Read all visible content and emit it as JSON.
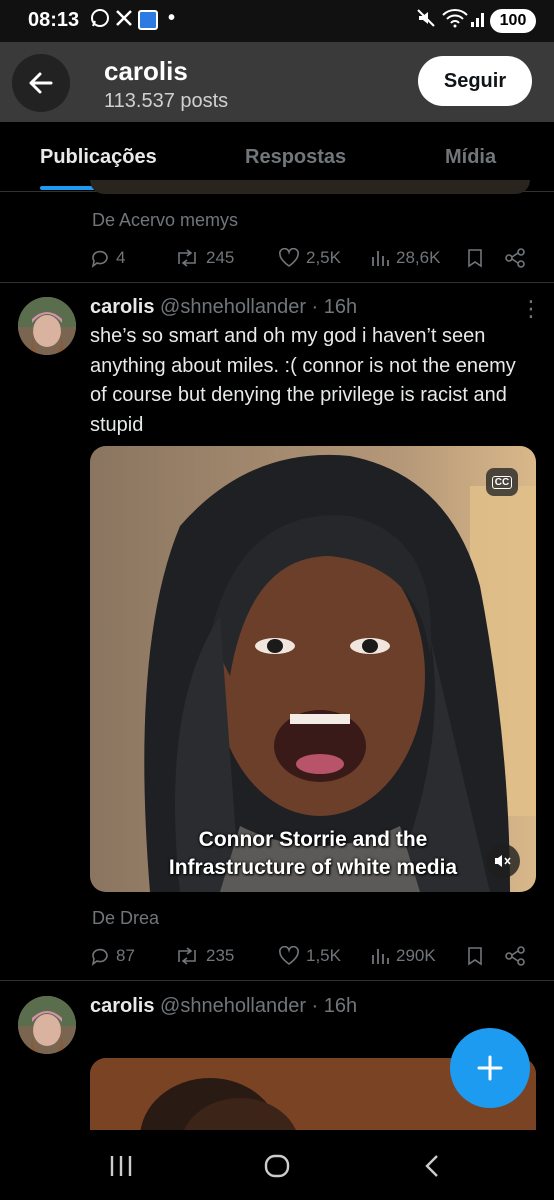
{
  "status_bar": {
    "time": "08:13",
    "battery": "100"
  },
  "header": {
    "name": "carolis",
    "posts": "113.537 posts",
    "follow_label": "Seguir"
  },
  "tabs": [
    {
      "label": "Publicações"
    },
    {
      "label": "Respostas"
    },
    {
      "label": "Mídia"
    }
  ],
  "prev_post": {
    "from": "De Acervo memys",
    "replies": "4",
    "reposts": "245",
    "likes": "2,5K",
    "views": "28,6K"
  },
  "post1": {
    "name": "carolis",
    "handle": "@shnehollander · 16h",
    "text": "she’s so smart and oh my god i haven’t seen anything about miles. :( connor is not the enemy of course but denying the privilege is racist and stupid",
    "video_caption_1": "Connor Storrie and the",
    "video_caption_2": "Infrastructure of white media",
    "cc_label": "CC",
    "from": "De Drea",
    "replies": "87",
    "reposts": "235",
    "likes": "1,5K",
    "views": "290K"
  },
  "post2": {
    "name": "carolis",
    "handle": "@shnehollander · 16h"
  },
  "colors": {
    "accent": "#1d9bf0",
    "background": "#000000",
    "muted": "#71767b"
  }
}
